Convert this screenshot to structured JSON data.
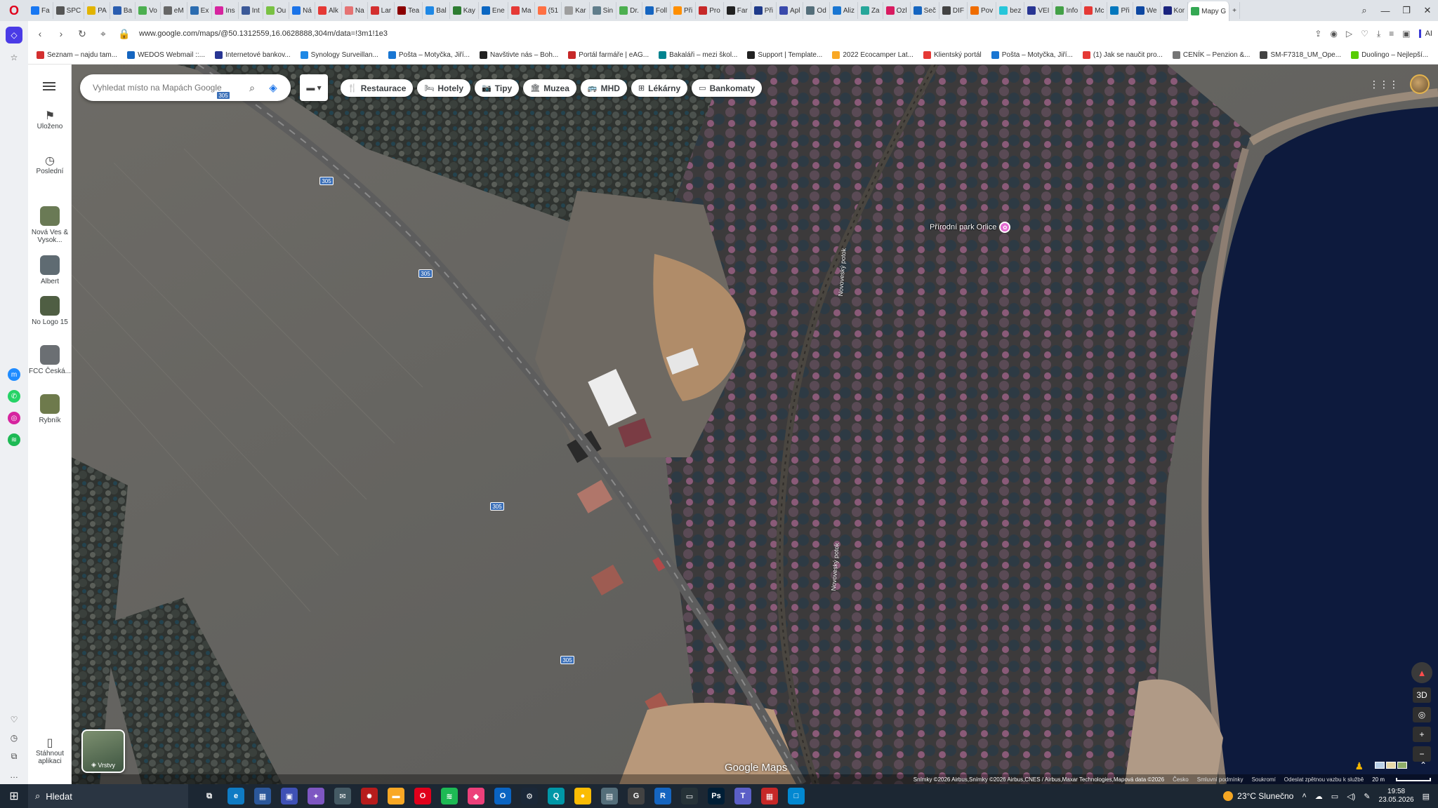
{
  "browser": {
    "tabs": [
      {
        "label": "Fa",
        "color": "#1877f2"
      },
      {
        "label": "SPC",
        "color": "#555555"
      },
      {
        "label": "PA",
        "color": "#e2b400"
      },
      {
        "label": "Ba",
        "color": "#2a5db0"
      },
      {
        "label": "Vo",
        "color": "#4caf50"
      },
      {
        "label": "eM",
        "color": "#666666"
      },
      {
        "label": "Ex",
        "color": "#2b6cb0"
      },
      {
        "label": "Ins",
        "color": "#d6249f"
      },
      {
        "label": "Int",
        "color": "#3b5998"
      },
      {
        "label": "Ou",
        "color": "#79c143"
      },
      {
        "label": "Ná",
        "color": "#1a73e8"
      },
      {
        "label": "Alk",
        "color": "#e53935"
      },
      {
        "label": "Na",
        "color": "#e57373"
      },
      {
        "label": "Lar",
        "color": "#d32f2f"
      },
      {
        "label": "Tea",
        "color": "#8b0000"
      },
      {
        "label": "Bal",
        "color": "#1e88e5"
      },
      {
        "label": "Kay",
        "color": "#2e7d32"
      },
      {
        "label": "Ene",
        "color": "#0a66c2"
      },
      {
        "label": "Ma",
        "color": "#e53935"
      },
      {
        "label": "(51",
        "color": "#ff7043"
      },
      {
        "label": "Kar",
        "color": "#9e9e9e"
      },
      {
        "label": "Sin",
        "color": "#607d8b"
      },
      {
        "label": "Dr.",
        "color": "#4caf50"
      },
      {
        "label": "Foll",
        "color": "#1565c0"
      },
      {
        "label": "Při",
        "color": "#ff8f00"
      },
      {
        "label": "Pro",
        "color": "#c62828"
      },
      {
        "label": "Far",
        "color": "#212121"
      },
      {
        "label": "Při",
        "color": "#1e3a8a"
      },
      {
        "label": "Apl",
        "color": "#3949ab"
      },
      {
        "label": "Od",
        "color": "#546e7a"
      },
      {
        "label": "Aliz",
        "color": "#1976d2"
      },
      {
        "label": "Za",
        "color": "#26a69a"
      },
      {
        "label": "Ozl",
        "color": "#d81b60"
      },
      {
        "label": "Seč",
        "color": "#1565c0"
      },
      {
        "label": "DIF",
        "color": "#424242"
      },
      {
        "label": "Pov",
        "color": "#ef6c00"
      },
      {
        "label": "bez",
        "color": "#26c6da"
      },
      {
        "label": "VEI",
        "color": "#283593"
      },
      {
        "label": "Info",
        "color": "#43a047"
      },
      {
        "label": "Mc",
        "color": "#e53935"
      },
      {
        "label": "Při",
        "color": "#0277bd"
      },
      {
        "label": "We",
        "color": "#0d47a1"
      },
      {
        "label": "Kor",
        "color": "#1a237e"
      },
      {
        "label": "Mapy G",
        "color": "#34a853",
        "active": true
      }
    ],
    "url": "www.google.com/maps/@50.1312559,16.0628888,304m/data=!3m1!1e3",
    "ai_label": "AI",
    "bookmarks": [
      {
        "label": "Seznam – najdu tam...",
        "color": "#d32f2f"
      },
      {
        "label": "WEDOS Webmail ::...",
        "color": "#1565c0"
      },
      {
        "label": "Internetové bankov...",
        "color": "#283593"
      },
      {
        "label": "Synology Surveillan...",
        "color": "#1e88e5"
      },
      {
        "label": "Pošta – Motyčka, Jiří...",
        "color": "#1976d2"
      },
      {
        "label": "Navštivte nás – Boh...",
        "color": "#212121"
      },
      {
        "label": "Portál farmáře | eAG...",
        "color": "#c62828"
      },
      {
        "label": "Bakaláři – mezi škol...",
        "color": "#00838f"
      },
      {
        "label": "Support | Template...",
        "color": "#212121"
      },
      {
        "label": "2022 Ecocamper Lat...",
        "color": "#f9a825"
      },
      {
        "label": "Klientský portál",
        "color": "#e53935"
      },
      {
        "label": "Pošta – Motyčka, Jiří...",
        "color": "#1976d2"
      },
      {
        "label": "(1) Jak se naučit pro...",
        "color": "#e53935"
      },
      {
        "label": "CENÍK – Penzion &...",
        "color": "#757575"
      },
      {
        "label": "SM-F7318_UM_Ope...",
        "color": "#424242"
      },
      {
        "label": "Duolingo – Nejlepší...",
        "color": "#58cc02"
      }
    ]
  },
  "rail": {
    "saved": "Uloženo",
    "recent": "Poslední",
    "recent_places": [
      {
        "label": "Nová Ves & Vysok...",
        "color": "#6a7a55"
      },
      {
        "label": "Albert",
        "color": "#5f6b72"
      },
      {
        "label": "No Logo 15",
        "color": "#4f5e43"
      },
      {
        "label": "FCC Česká...",
        "color": "#6b6f73"
      },
      {
        "label": "Rybník",
        "color": "#6e7a4c"
      }
    ],
    "download_app": "Stáhnout aplikaci"
  },
  "map": {
    "search_placeholder": "Vyhledat místo na Mapách Google",
    "chips": [
      {
        "label": "Restaurace",
        "icon": "fork-knife-icon",
        "glyph": "🍴"
      },
      {
        "label": "Hotely",
        "icon": "bed-icon",
        "glyph": "🛏"
      },
      {
        "label": "Tipy",
        "icon": "camera-icon",
        "glyph": "📷"
      },
      {
        "label": "Muzea",
        "icon": "museum-icon",
        "glyph": "🏛"
      },
      {
        "label": "MHD",
        "icon": "bus-icon",
        "glyph": "🚌"
      },
      {
        "label": "Lékárny",
        "icon": "pharmacy-icon",
        "glyph": "⊞"
      },
      {
        "label": "Bankomaty",
        "icon": "atm-icon",
        "glyph": "▭"
      }
    ],
    "poi": "Přírodní park Orlice",
    "road_number": "305",
    "stream_name": "Novoveský potok",
    "layers_label": "Vrstvy",
    "watermark": "Google Maps",
    "three_d": "3D",
    "attribution": "Snímky ©2026 Airbus,Snímky ©2026 Airbus,CNES / Airbus,Maxar Technologies,Mapová data ©2026",
    "links": [
      "Česko",
      "Smluvní podmínky",
      "Soukromí",
      "Odeslat zpětnou vazbu k službě"
    ],
    "scale": "20 m"
  },
  "taskbar": {
    "search": "Hledat",
    "weather": "23°C  Slunečno",
    "time": "19:58",
    "date": "23.05.2026",
    "apps": [
      {
        "name": "edge-app",
        "color": "#0f7bc4",
        "glyph": "e"
      },
      {
        "name": "store-app",
        "color": "#2b579a",
        "glyph": "▦"
      },
      {
        "name": "save-app",
        "color": "#3f51b5",
        "glyph": "▣"
      },
      {
        "name": "copilot-app",
        "color": "#7e57c2",
        "glyph": "✦"
      },
      {
        "name": "mail-app",
        "color": "#455a64",
        "glyph": "✉"
      },
      {
        "name": "game-app",
        "color": "#b71c1c",
        "glyph": "✹"
      },
      {
        "name": "explorer-app",
        "color": "#f9a825",
        "glyph": "▬"
      },
      {
        "name": "opera-app",
        "color": "#e0001b",
        "glyph": "O"
      },
      {
        "name": "spotify-app",
        "color": "#1db954",
        "glyph": "≋"
      },
      {
        "name": "photos-app",
        "color": "#ec407a",
        "glyph": "◆"
      },
      {
        "name": "outlook-app",
        "color": "#0a64c2",
        "glyph": "O"
      },
      {
        "name": "steam-app",
        "color": "#1b2838",
        "glyph": "⚙"
      },
      {
        "name": "search-app",
        "color": "#0097a7",
        "glyph": "Q"
      },
      {
        "name": "chrome-app",
        "color": "#fbbc04",
        "glyph": "●"
      },
      {
        "name": "calc-app",
        "color": "#546e7a",
        "glyph": "▤"
      },
      {
        "name": "g-app",
        "color": "#424242",
        "glyph": "G"
      },
      {
        "name": "r-app",
        "color": "#1565c0",
        "glyph": "R"
      },
      {
        "name": "terminal-app",
        "color": "#263238",
        "glyph": "▭"
      },
      {
        "name": "photoshop-app",
        "color": "#001e36",
        "glyph": "Ps"
      },
      {
        "name": "teams-app",
        "color": "#5b5fc7",
        "glyph": "T"
      },
      {
        "name": "calendar-app",
        "color": "#c62828",
        "glyph": "▦"
      },
      {
        "name": "window-app",
        "color": "#0288d1",
        "glyph": "□"
      }
    ]
  }
}
